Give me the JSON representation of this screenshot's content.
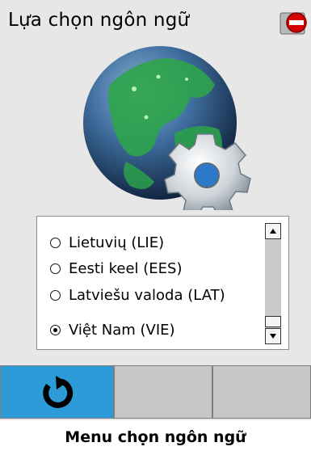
{
  "header": {
    "title": "Lựa chọn ngôn ngữ",
    "stop_icon": "no-entry-icon"
  },
  "graphic": {
    "icon": "globe-with-gear-icon"
  },
  "language_list": {
    "items": [
      {
        "label": "Lietuvių (LIE)",
        "selected": false
      },
      {
        "label": "Eesti keel (EES)",
        "selected": false
      },
      {
        "label": "Latviešu valoda (LAT)",
        "selected": false
      },
      {
        "label": "Việt Nam (VIE)",
        "selected": true
      }
    ],
    "scroll_position": 0.92
  },
  "bottom_bar": {
    "refresh_icon": "refresh-icon",
    "accent_color": "#2e9bd9"
  },
  "caption": "Menu chọn ngôn ngữ"
}
